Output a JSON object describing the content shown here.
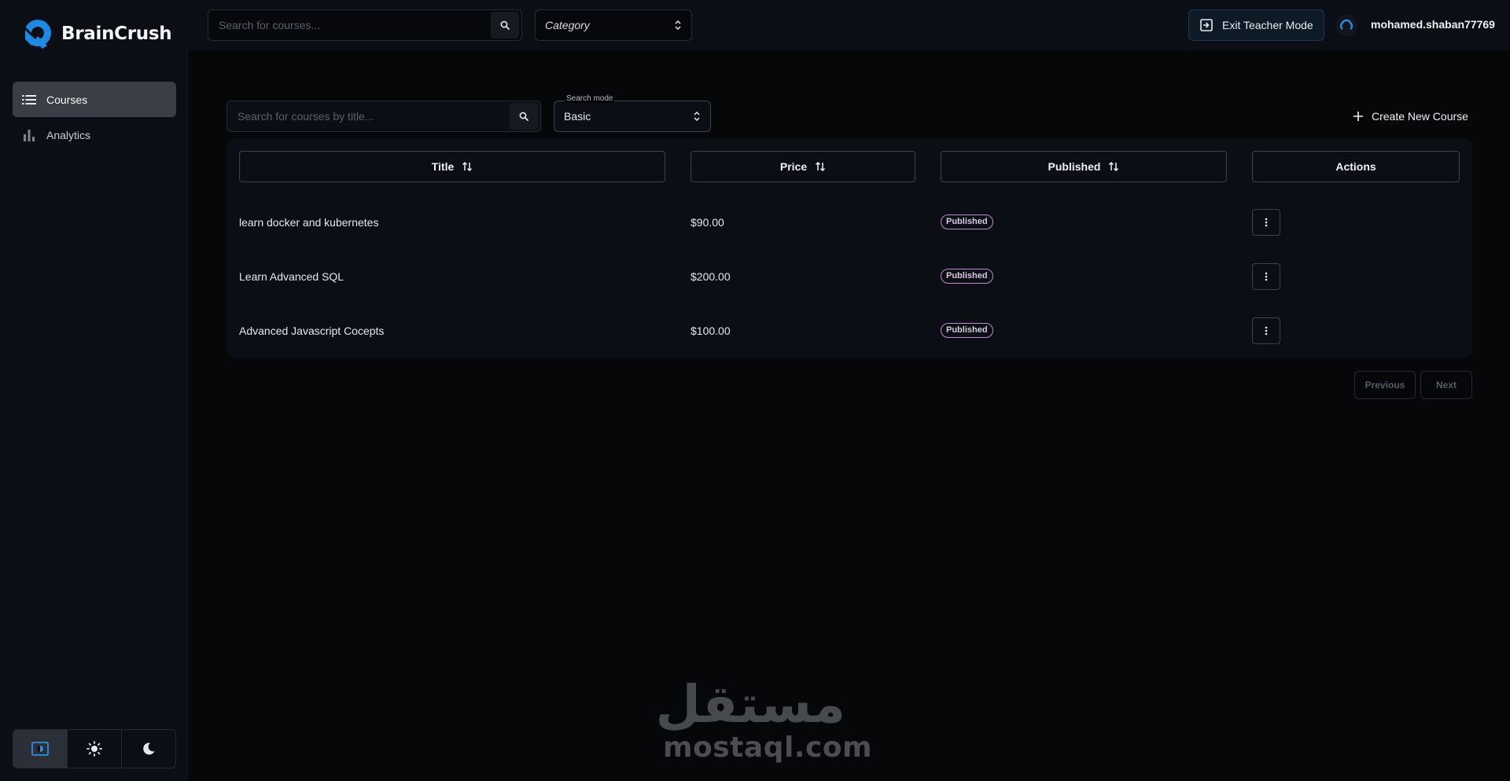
{
  "brand": {
    "name": "BrainCrush",
    "logo_icon": "braincrush-logo-icon",
    "accent": "#1e88e5"
  },
  "sidebar": {
    "items": [
      {
        "label": "Courses",
        "icon": "list-icon",
        "active": true
      },
      {
        "label": "Analytics",
        "icon": "bar-chart-icon",
        "active": false
      }
    ]
  },
  "theme_switch": {
    "options": [
      {
        "icon": "system-theme-icon",
        "active": true
      },
      {
        "icon": "sun-icon",
        "active": false
      },
      {
        "icon": "moon-icon",
        "active": false
      }
    ]
  },
  "topbar": {
    "search_placeholder": "Search for courses...",
    "category_label": "Category",
    "exit_button_label": "Exit Teacher Mode",
    "username": "mohamed.shaban77769"
  },
  "toolbar": {
    "search_placeholder": "Search for courses by title...",
    "search_mode_label": "Search mode",
    "search_mode_value": "Basic",
    "create_label": "Create New Course"
  },
  "table": {
    "columns": {
      "title": "Title",
      "price": "Price",
      "published": "Published",
      "actions": "Actions"
    },
    "rows": [
      {
        "title": "learn docker and kubernetes",
        "price": "$90.00",
        "status": "Published"
      },
      {
        "title": "Learn Advanced SQL",
        "price": "$200.00",
        "status": "Published"
      },
      {
        "title": "Advanced Javascript Cocepts",
        "price": "$100.00",
        "status": "Published"
      }
    ]
  },
  "pagination": {
    "previous_label": "Previous",
    "next_label": "Next"
  },
  "watermark": {
    "arabic": "مستقل",
    "latin": "mostaql.com"
  }
}
